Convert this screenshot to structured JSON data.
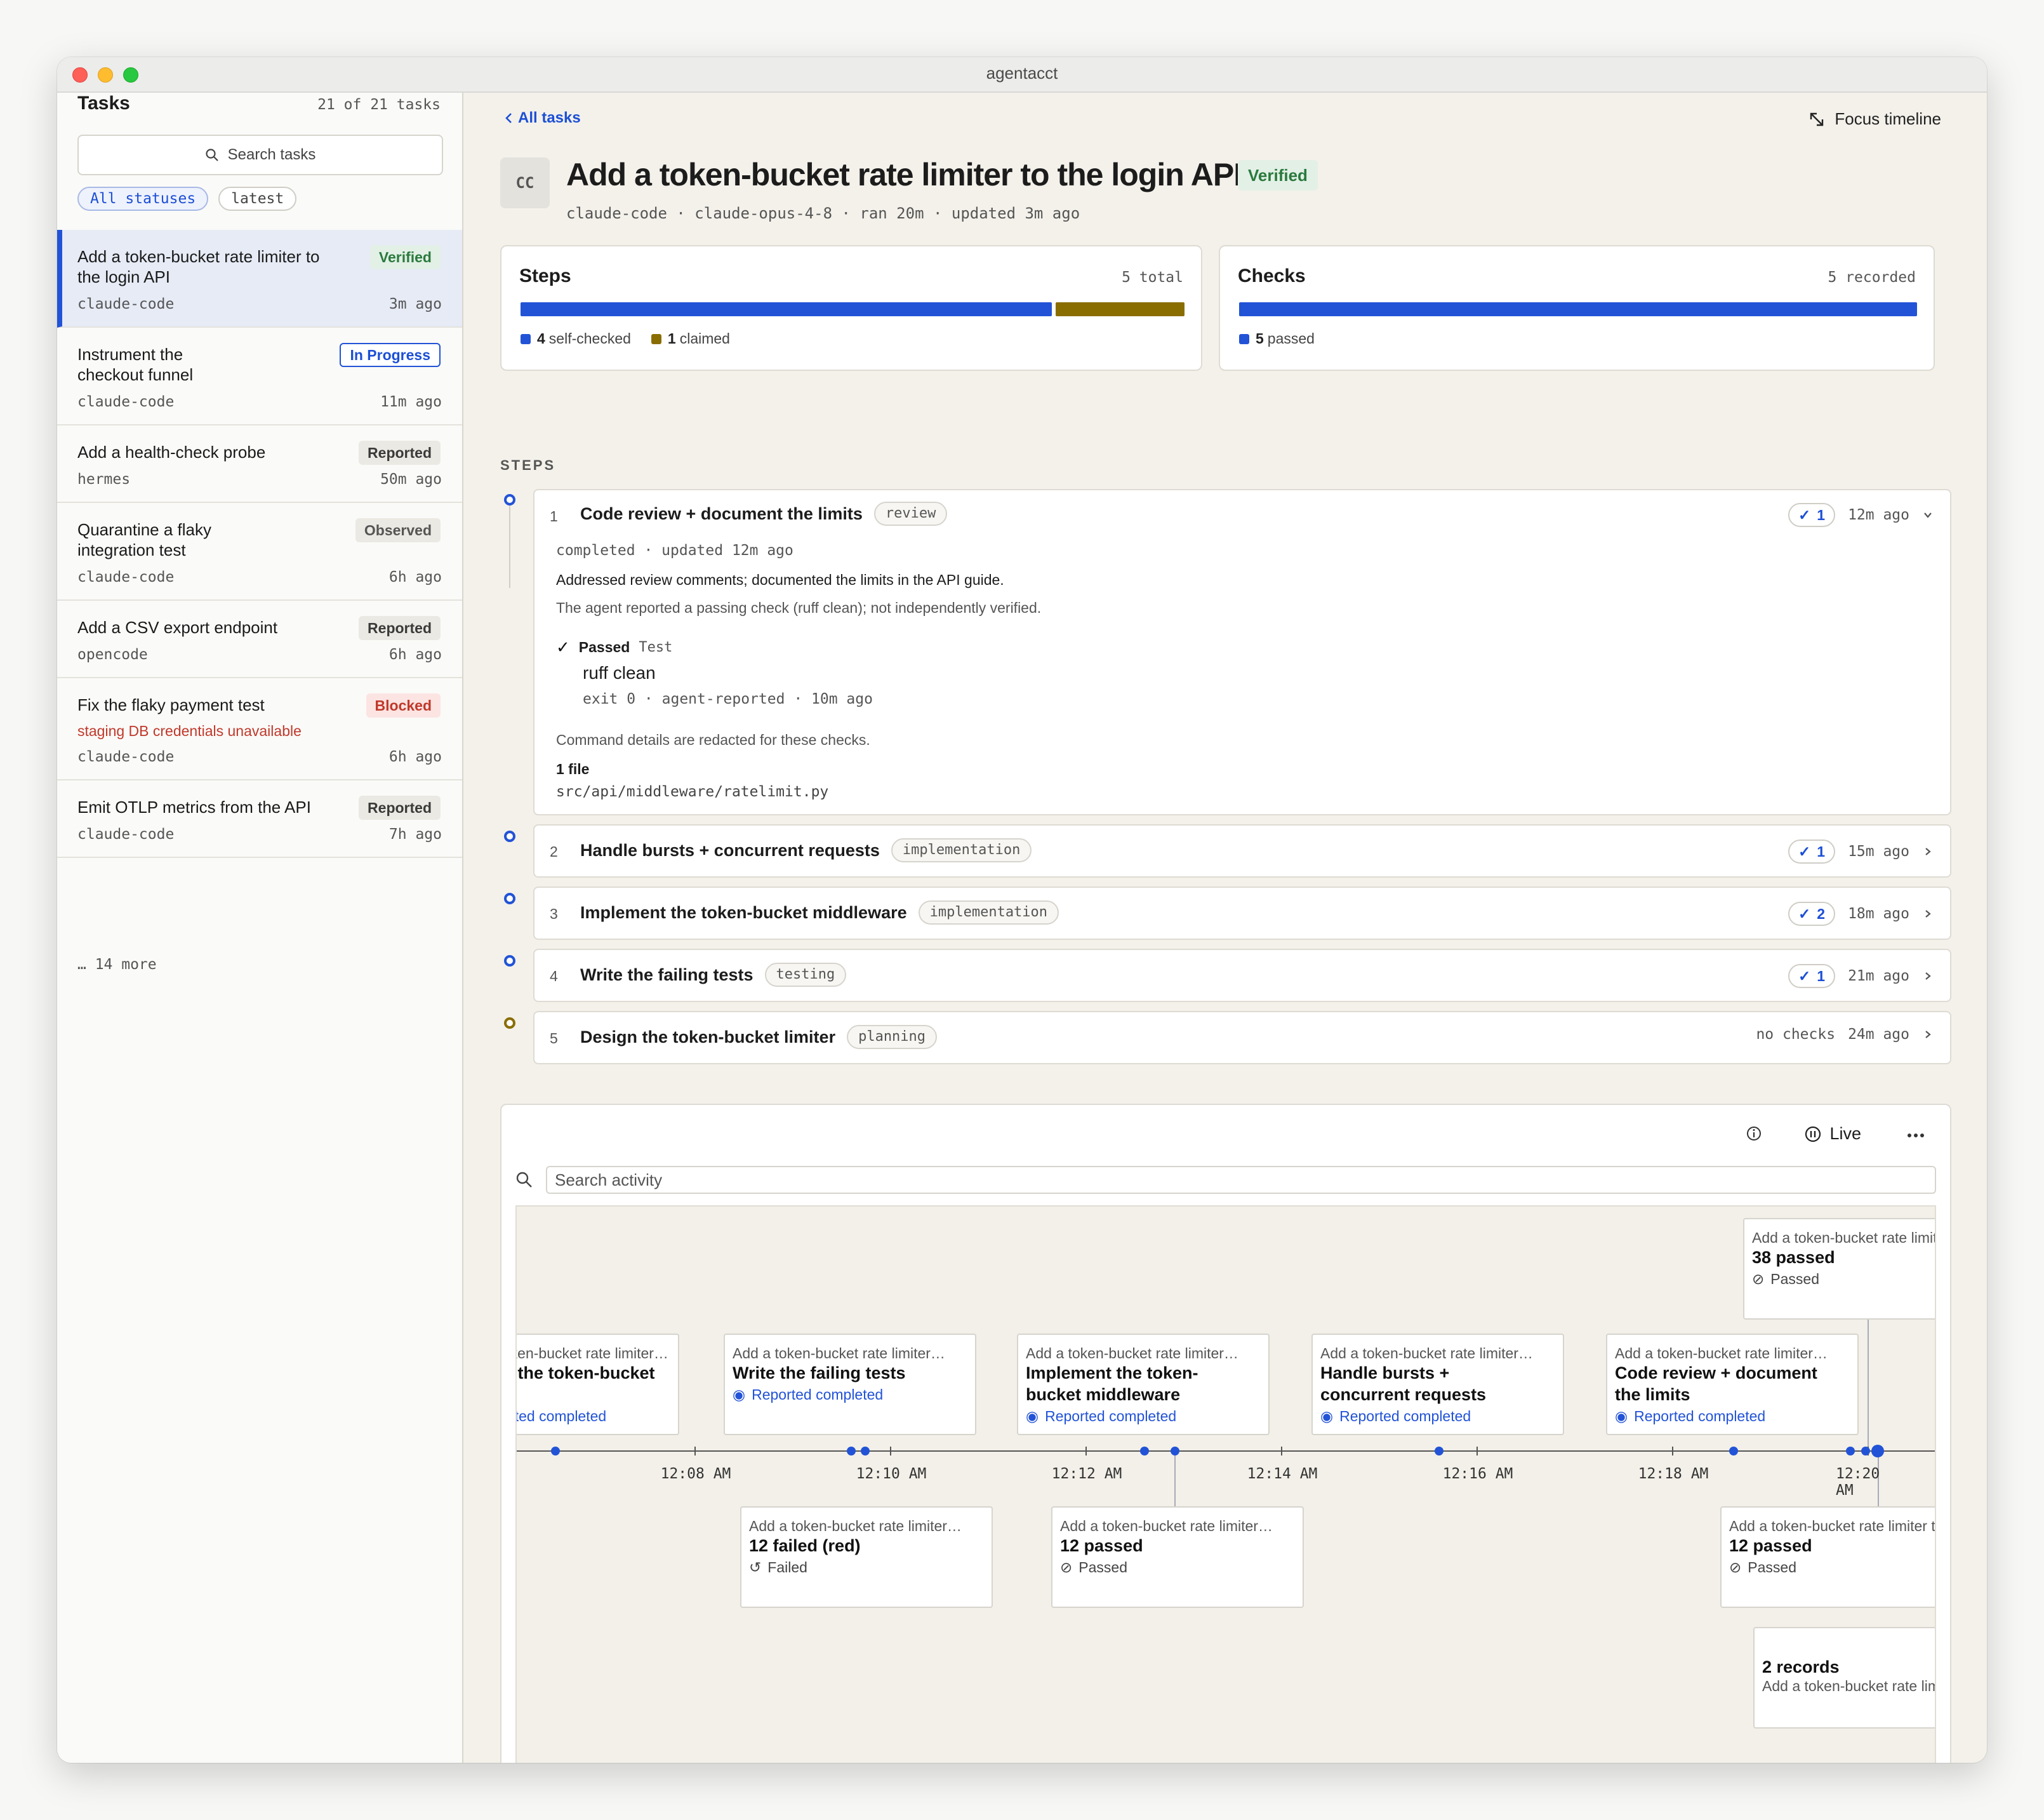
{
  "window": {
    "title": "agentacct"
  },
  "sidebar": {
    "title": "Tasks",
    "count": "21 of 21 tasks",
    "search_placeholder": "Search tasks",
    "filters": [
      "All statuses",
      "latest"
    ],
    "tasks": [
      {
        "name": "Add a token-bucket rate limiter to the login API",
        "badge": "Verified",
        "agent": "claude-code",
        "age": "3m ago"
      },
      {
        "name": "Instrument the checkout funnel",
        "badge": "In Progress",
        "agent": "claude-code",
        "age": "11m ago"
      },
      {
        "name": "Add a health-check probe",
        "badge": "Reported",
        "agent": "hermes",
        "age": "50m ago"
      },
      {
        "name": "Quarantine a flaky integration test",
        "badge": "Observed",
        "agent": "claude-code",
        "age": "6h ago"
      },
      {
        "name": "Add a CSV export endpoint",
        "badge": "Reported",
        "agent": "opencode",
        "age": "6h ago"
      },
      {
        "name": "Fix the flaky payment test",
        "badge": "Blocked",
        "error": "staging DB credentials unavailable",
        "agent": "claude-code",
        "age": "6h ago"
      },
      {
        "name": "Emit OTLP metrics from the API",
        "badge": "Reported",
        "agent": "claude-code",
        "age": "7h ago"
      }
    ],
    "more": "… 14 more"
  },
  "main": {
    "back": "All tasks",
    "focus": "Focus timeline",
    "avatar": "CC",
    "title": "Add a token-bucket rate limiter to the login API",
    "badge": "Verified",
    "meta": "claude-code · claude-opus-4-8 · ran 20m · updated 3m ago"
  },
  "steps_card": {
    "title": "Steps",
    "count": "5 total",
    "self_checked_n": "4",
    "self_checked_label": "self-checked",
    "claimed_n": "1",
    "claimed_label": "claimed",
    "self_checked": 4,
    "claimed": 1
  },
  "checks_card": {
    "title": "Checks",
    "count": "5 recorded",
    "passed_n": "5",
    "passed_label": "passed",
    "passed": 5
  },
  "colors": {
    "accent": "#2253d7",
    "claimed": "#8a6d00",
    "verified": "#2a7a3d",
    "blocked": "#c0392b"
  },
  "steps_label": "STEPS",
  "steps": [
    {
      "num": "1",
      "name": "Code review + document the limits",
      "tag": "review",
      "checks": "1",
      "age": "12m ago",
      "status_line": "completed · updated 12m ago",
      "summary": "Addressed review comments; documented the limits in the API guide.",
      "note": "The agent reported a passing check (ruff clean); not independently verified.",
      "check_result": "Passed",
      "check_kind": "Test",
      "check_name": "ruff clean",
      "check_meta": "exit 0 · agent-reported · 10m ago",
      "redacted": "Command details are redacted for these checks.",
      "files_label": "1 file",
      "file": "src/api/middleware/ratelimit.py"
    },
    {
      "num": "2",
      "name": "Handle bursts + concurrent requests",
      "tag": "implementation",
      "checks": "1",
      "age": "15m ago"
    },
    {
      "num": "3",
      "name": "Implement the token-bucket middleware",
      "tag": "implementation",
      "checks": "2",
      "age": "18m ago"
    },
    {
      "num": "4",
      "name": "Write the failing tests",
      "tag": "testing",
      "checks": "1",
      "age": "21m ago"
    },
    {
      "num": "5",
      "name": "Design the token-bucket limiter",
      "tag": "planning",
      "checks": "no checks",
      "age": "24m ago"
    }
  ],
  "activity": {
    "live": "Live",
    "search_placeholder": "Search activity",
    "ticks": [
      "12:08 AM",
      "12:10 AM",
      "12:12 AM",
      "12:14 AM",
      "12:16 AM",
      "12:18 AM",
      "12:20 AM"
    ],
    "events_top": [
      {
        "head": "Add a token-bucket rate limiter…",
        "title": "Design the token-bucket limiter",
        "status": "Reported completed"
      },
      {
        "head": "Add a token-bucket rate limiter…",
        "title": "Write the failing tests",
        "status": "Reported completed"
      },
      {
        "head": "Add a token-bucket rate limiter…",
        "title": "Implement the token-bucket middleware",
        "status": "Reported completed"
      },
      {
        "head": "Add a token-bucket rate limiter…",
        "title": "Handle bursts + concurrent requests",
        "status": "Reported completed"
      },
      {
        "head": "Add a token-bucket rate limiter…",
        "title": "Code review + document the limits",
        "status": "Reported completed"
      },
      {
        "head": "Add a token-bucket rate limiter to the login API",
        "title": "38 passed",
        "status": "Passed"
      }
    ],
    "events_bottom": [
      {
        "head": "Add a token-bucket rate limiter…",
        "title": "12 failed (red)",
        "status": "Failed"
      },
      {
        "head": "Add a token-bucket rate limiter…",
        "title": "12 passed",
        "status": "Passed"
      },
      {
        "head": "Add a token-bucket rate limiter to the login API",
        "title": "12 passed",
        "status": "Passed"
      },
      {
        "head": "",
        "title": "2 records",
        "status": "Add a token-bucket rate limiter to the login API"
      }
    ]
  }
}
